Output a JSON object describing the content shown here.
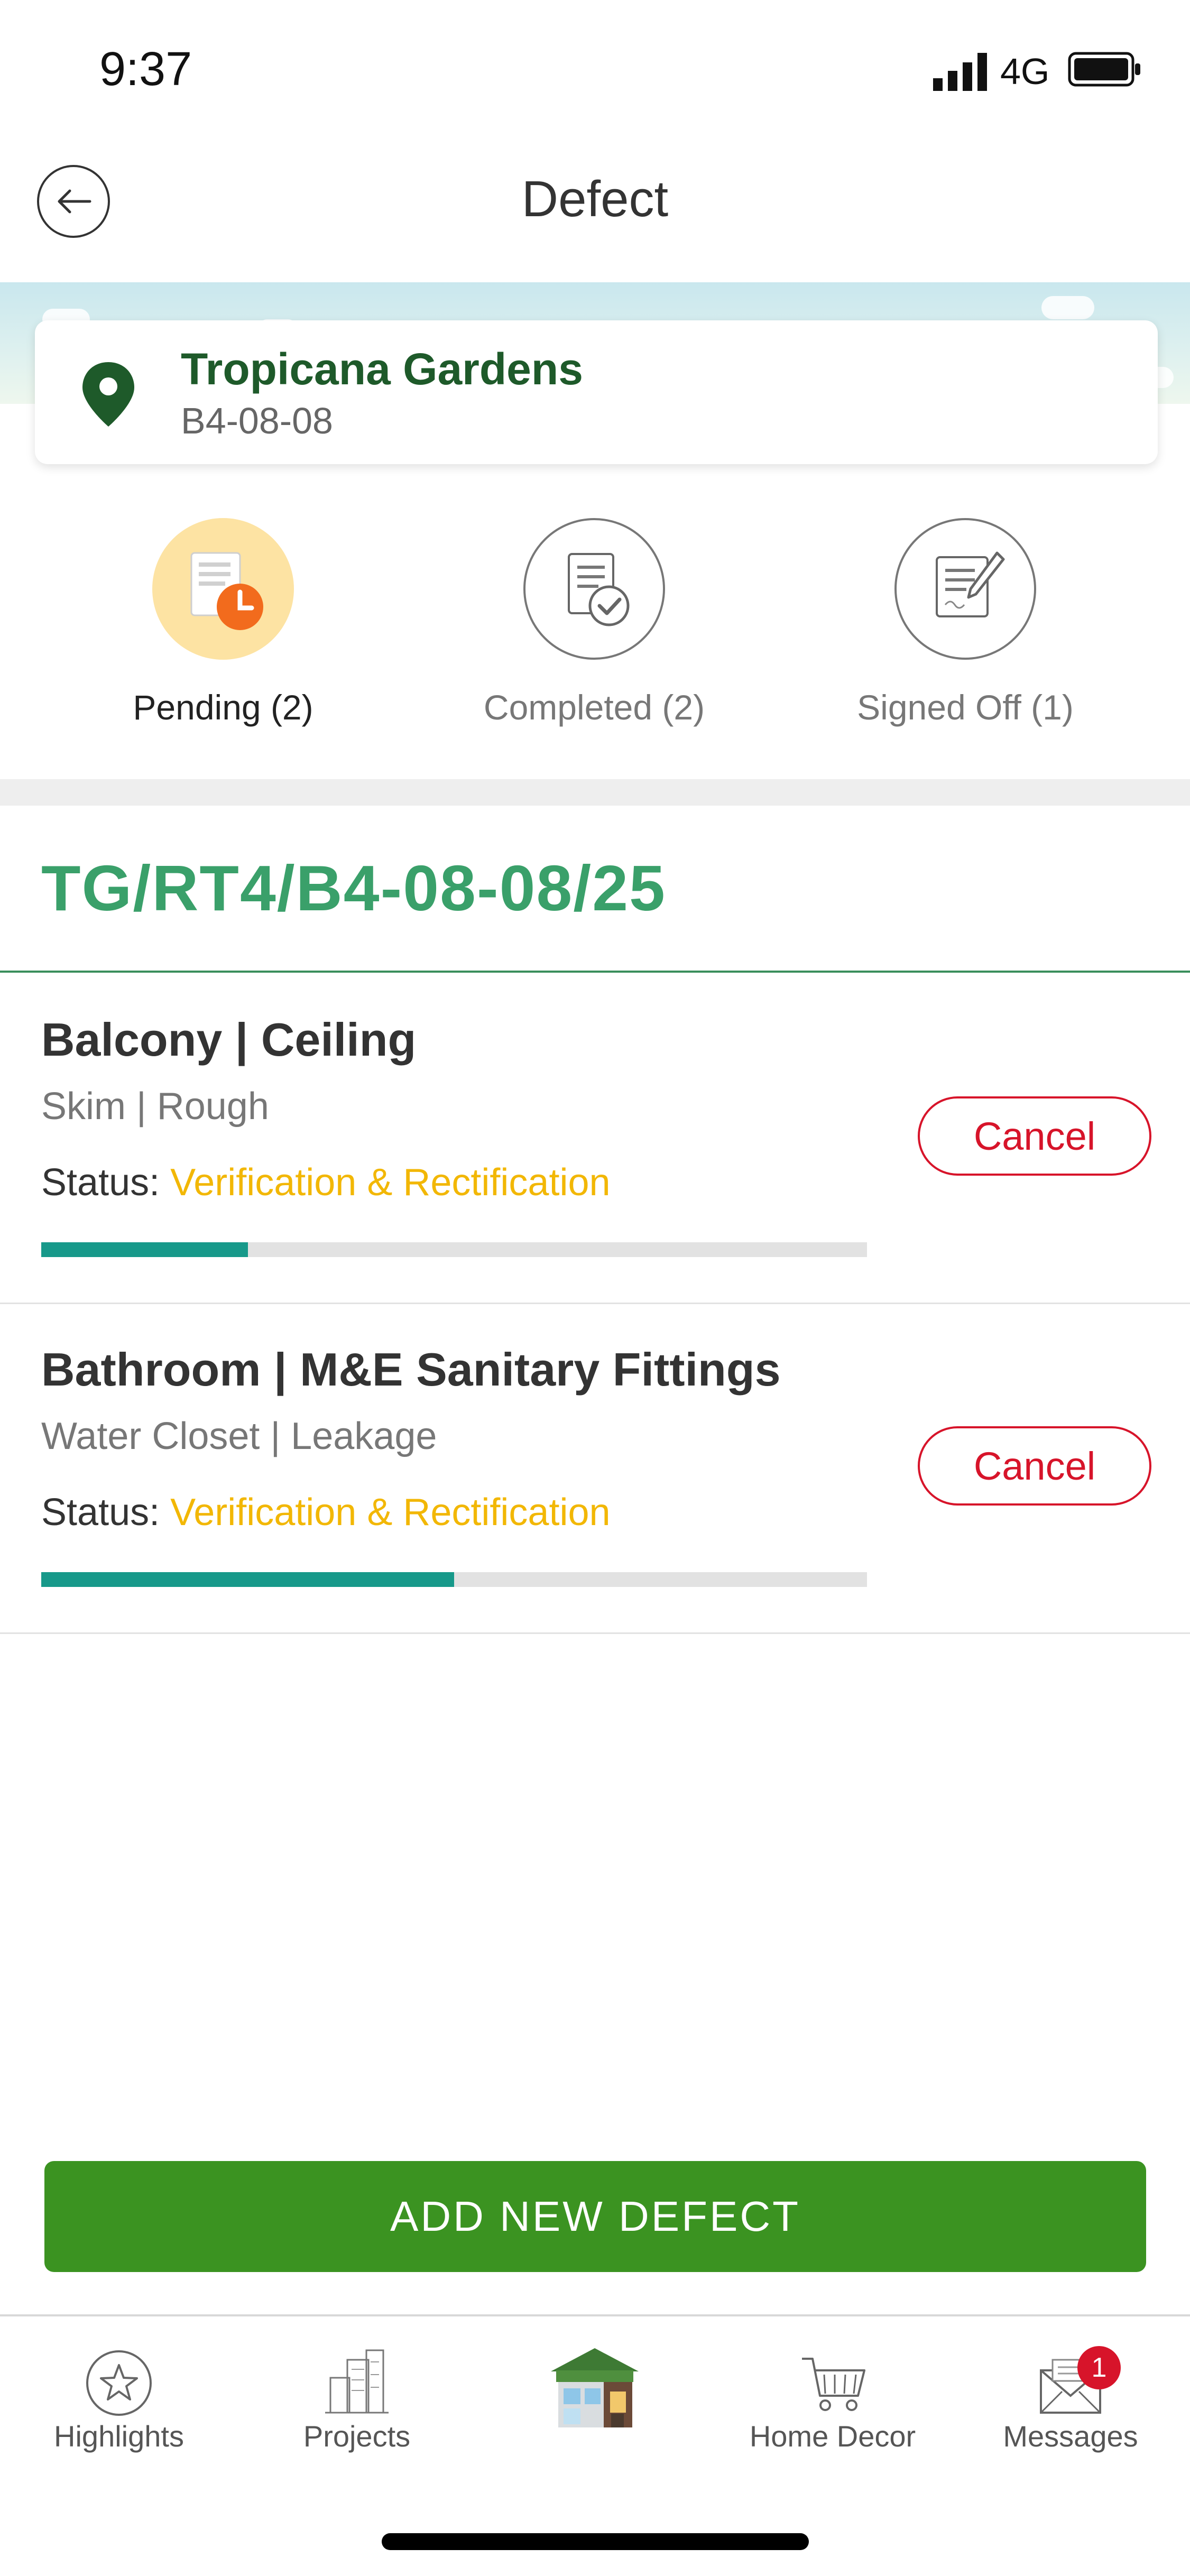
{
  "status_bar": {
    "time": "9:37",
    "network": "4G"
  },
  "header": {
    "title": "Defect"
  },
  "location": {
    "name": "Tropicana Gardens",
    "unit": "B4-08-08"
  },
  "tabs": [
    {
      "label": "Pending (2)",
      "icon": "pending-clock-icon",
      "active": true
    },
    {
      "label": "Completed (2)",
      "icon": "completed-check-icon",
      "active": false
    },
    {
      "label": "Signed Off (1)",
      "icon": "signed-off-pen-icon",
      "active": false
    }
  ],
  "reference": "TG/RT4/B4-08-08/25",
  "defects": [
    {
      "title": "Balcony | Ceiling",
      "subtitle": "Skim | Rough",
      "status_label": "Status:",
      "status_value": "Verification & Rectification",
      "progress": 0.25,
      "cancel_label": "Cancel"
    },
    {
      "title": "Bathroom | M&E Sanitary Fittings",
      "subtitle": "Water Closet | Leakage",
      "status_label": "Status:",
      "status_value": "Verification & Rectification",
      "progress": 0.5,
      "cancel_label": "Cancel"
    }
  ],
  "add_button": "ADD NEW DEFECT",
  "nav": [
    {
      "label": "Highlights",
      "icon": "star-icon"
    },
    {
      "label": "Projects",
      "icon": "buildings-icon"
    },
    {
      "label": "",
      "icon": "house-icon"
    },
    {
      "label": "Home Decor",
      "icon": "cart-icon"
    },
    {
      "label": "Messages",
      "icon": "envelope-icon",
      "badge": "1"
    }
  ],
  "colors": {
    "brand_green": "#3b9321",
    "ref_green": "#3aa06a",
    "status_yellow": "#f2b705",
    "progress_teal": "#17998a",
    "cancel_red": "#d7142a"
  }
}
